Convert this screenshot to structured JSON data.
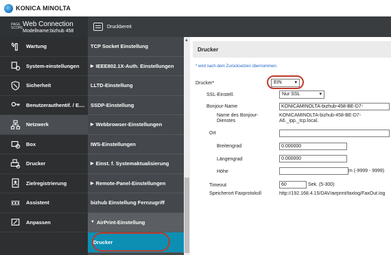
{
  "brand": {
    "name": "KONICA MINOLTA"
  },
  "header": {
    "pagescope": "PAGE SCOPE",
    "title": "Web Connection",
    "model": "Modellname:bizhub 458",
    "status": "Druckbereit"
  },
  "main_menu": [
    {
      "label": "Wartung",
      "icon": "maintenance-icon"
    },
    {
      "label": "System-einstellungen",
      "icon": "system-settings-icon"
    },
    {
      "label": "Sicherheit",
      "icon": "shield-icon"
    },
    {
      "label": "Benutzerauthentif. / E....",
      "icon": "user-auth-icon"
    },
    {
      "label": "Netzwerk",
      "icon": "network-icon",
      "active": true
    },
    {
      "label": "Box",
      "icon": "box-icon"
    },
    {
      "label": "Drucker",
      "icon": "printer-icon"
    },
    {
      "label": "Zielregistrierung",
      "icon": "address-book-icon"
    },
    {
      "label": "Assistent",
      "icon": "wizard-icon"
    },
    {
      "label": "Anpassen",
      "icon": "customize-icon"
    }
  ],
  "sub_menu": [
    {
      "label": "TCP Socket Einstellung",
      "caret": ""
    },
    {
      "label": "IEEE802.1X-Auth. Einstellungen",
      "caret": "▶"
    },
    {
      "label": "LLTD-Einstellung",
      "caret": ""
    },
    {
      "label": "SSDP-Einstellung",
      "caret": ""
    },
    {
      "label": "Webbrowser-Einstellungen",
      "caret": "▶"
    },
    {
      "label": "IWS-Einstellungen",
      "caret": ""
    },
    {
      "label": "Einst. f. Systemaktualisierung",
      "caret": "▶"
    },
    {
      "label": "Remote-Panel-Einstellungen",
      "caret": "▶"
    },
    {
      "label": "bizhub Einstellung Fernzugriff",
      "caret": ""
    },
    {
      "label": "AirPrint-Einstellung",
      "caret": "▼"
    },
    {
      "label": "Drucker",
      "caret": ""
    }
  ],
  "content": {
    "title": "Drucker",
    "note": "* wird nach dem Zurücksetzen übernommen.",
    "drucker": {
      "label": "Drucker*",
      "value": "EIN"
    },
    "ssl": {
      "label": "SSL-Einstell.",
      "value": "Nur SSL"
    },
    "bonjour_name": {
      "label": "Bonjour-Name",
      "value": "KONICAMINOLTA-bizhub-458-BE-D7-"
    },
    "dienst": {
      "label": "Name des Bonjour-\nDienstes",
      "value_line1": "KONICAMINOLTA-bizhub-458-BE-D7-",
      "value_line2": "A6._ipp._tcp.local."
    },
    "ort": {
      "label": "Ort",
      "value": ""
    },
    "breitengrad": {
      "label": "Breitengrad",
      "value": "0.000000"
    },
    "laengengrad": {
      "label": "Längengrad",
      "value": "0.000000"
    },
    "hoehe": {
      "label": "Höhe",
      "value": "",
      "unit": "m (-9999 - 9999)"
    },
    "timeout": {
      "label": "Timeout",
      "value": "60",
      "unit": "Sek. (5-300)"
    },
    "faxprotokoll": {
      "label": "Speicherort Faxprotokoll",
      "value": "http://192.168.4.15/DAV/airprint/faxlog/FaxOut.log"
    }
  },
  "colors": {
    "accent_child": "#0d8fb3",
    "highlight": "#c0392b",
    "note_text": "#1a63c9"
  }
}
